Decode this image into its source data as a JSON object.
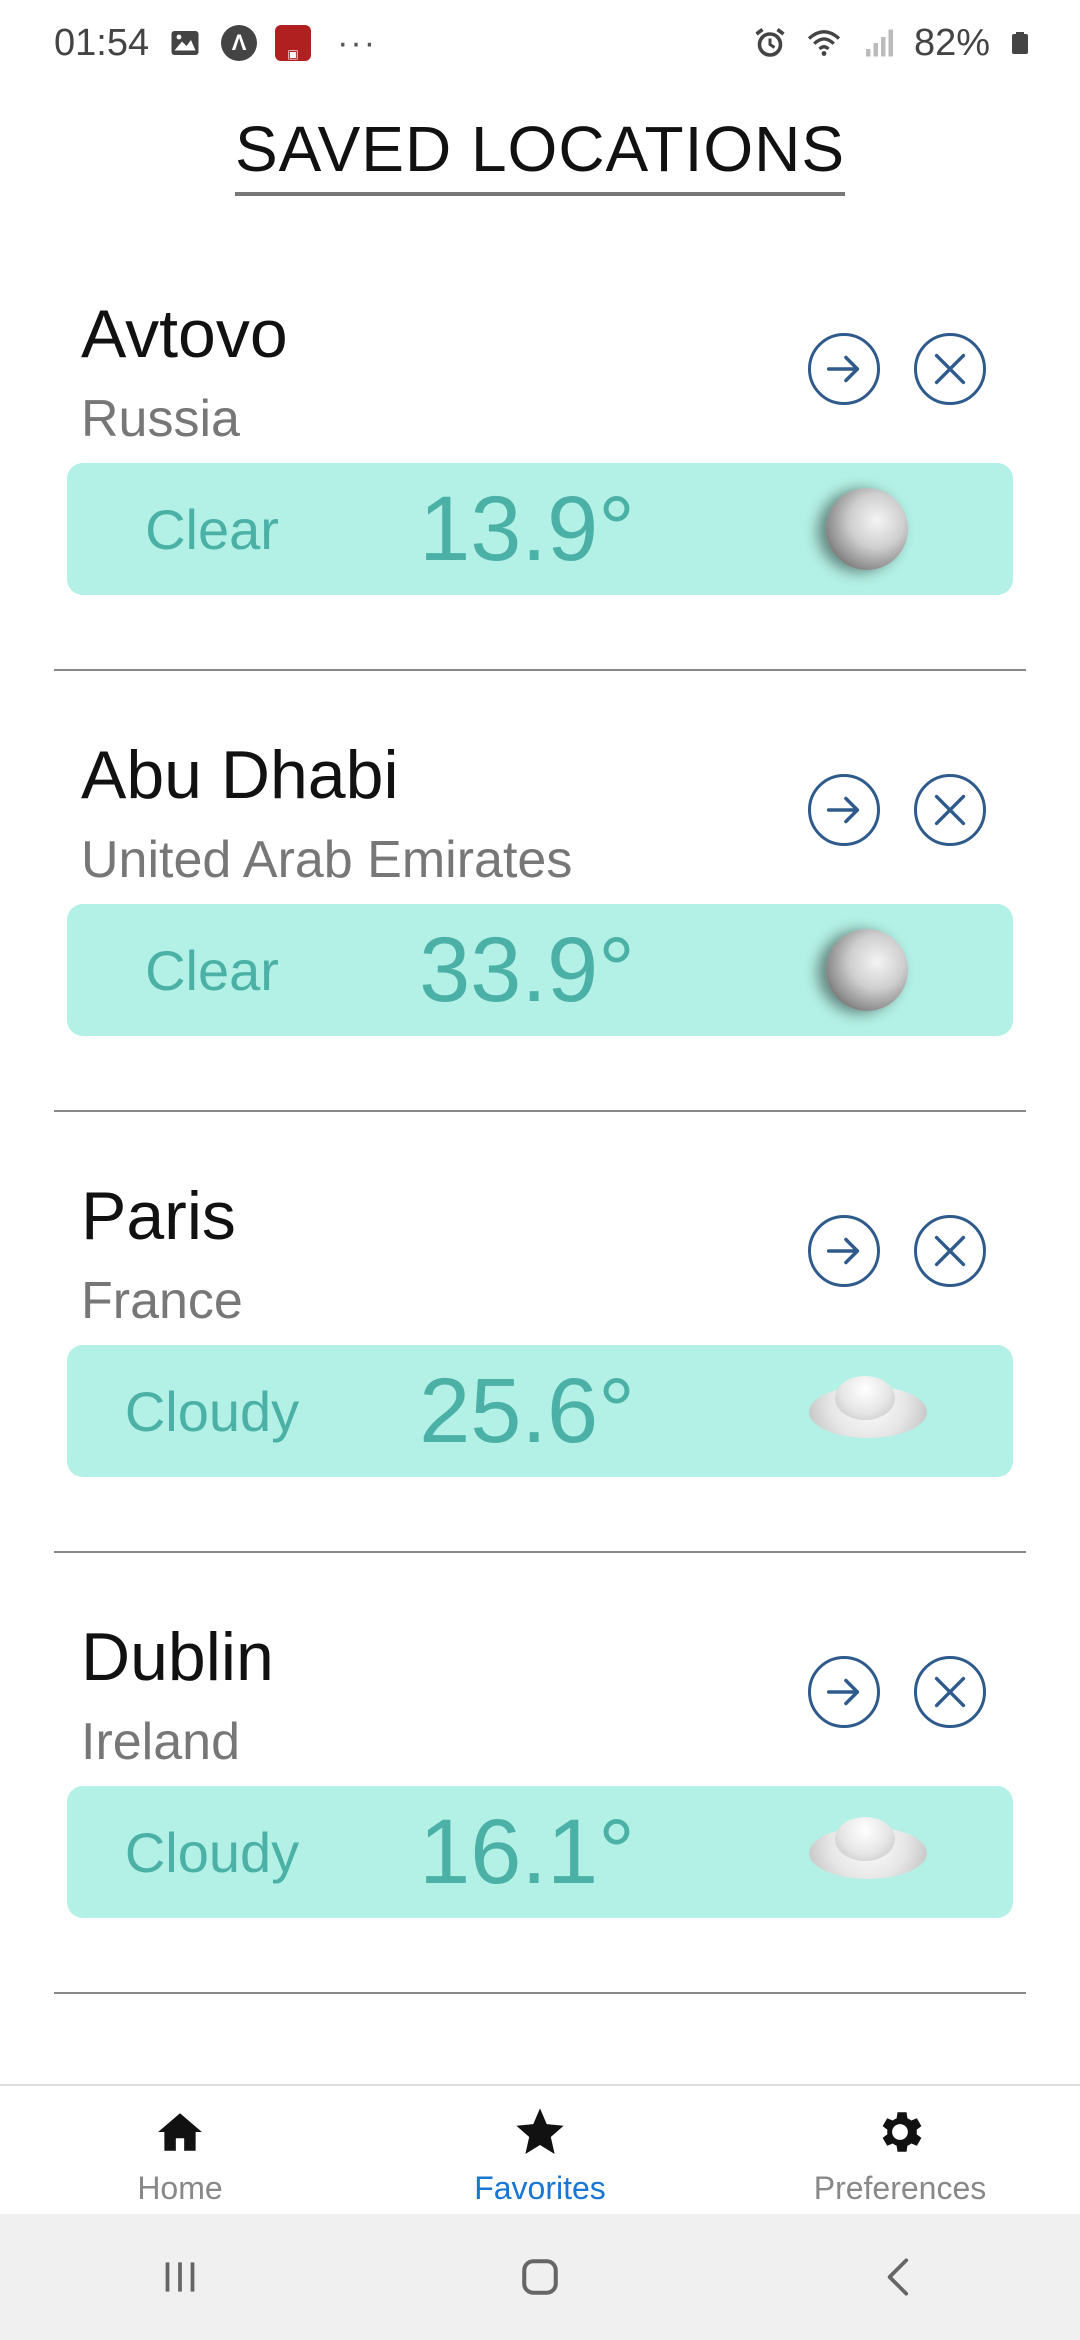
{
  "status_bar": {
    "time": "01:54",
    "battery": "82%",
    "overflow": "···"
  },
  "title": "SAVED LOCATIONS",
  "locations": [
    {
      "city": "Avtovo",
      "country": "Russia",
      "condition": "Clear",
      "temperature": "13.9°",
      "icon": "moon-icon"
    },
    {
      "city": "Abu Dhabi",
      "country": "United Arab Emirates",
      "condition": "Clear",
      "temperature": "33.9°",
      "icon": "moon-icon"
    },
    {
      "city": "Paris",
      "country": "France",
      "condition": "Cloudy",
      "temperature": "25.6°",
      "icon": "cloud-icon"
    },
    {
      "city": "Dublin",
      "country": "Ireland",
      "condition": "Cloudy",
      "temperature": "16.1°",
      "icon": "cloud-icon"
    }
  ],
  "bottom_nav": {
    "items": [
      {
        "label": "Home",
        "icon": "home-icon",
        "active": false
      },
      {
        "label": "Favorites",
        "icon": "star-icon",
        "active": true
      },
      {
        "label": "Preferences",
        "icon": "gear-icon",
        "active": false
      }
    ]
  },
  "colors": {
    "panel_bg": "#b3f0e5",
    "panel_text": "#4bb0a6",
    "action_icon": "#2f5a8c",
    "active_nav": "#1976d2"
  }
}
